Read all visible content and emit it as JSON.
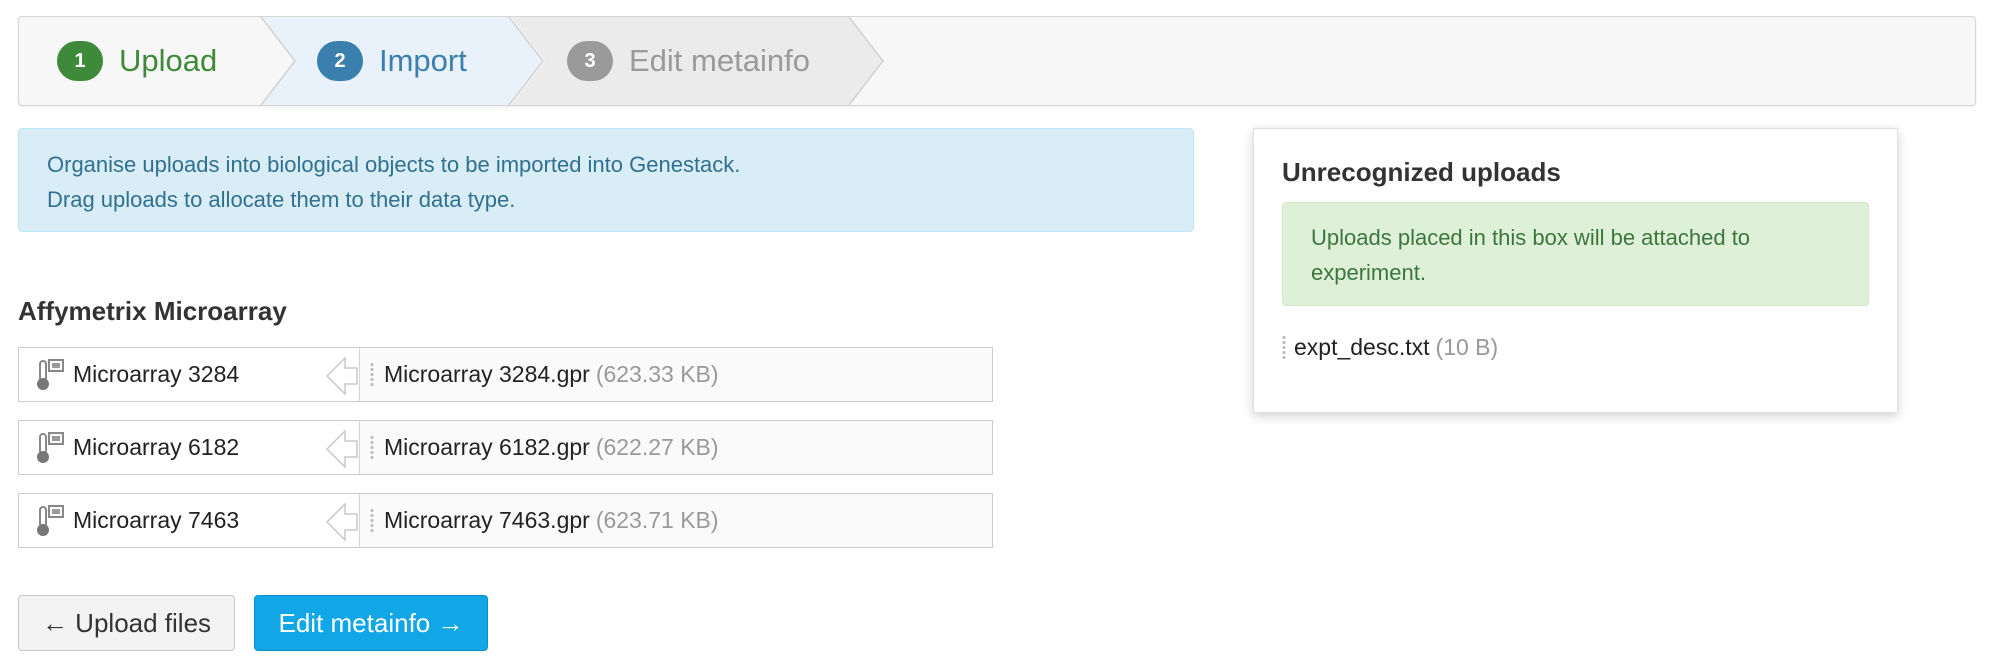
{
  "stepper": {
    "steps": [
      {
        "number": "1",
        "label": "Upload",
        "state": "completed",
        "color": "#3f8a3a"
      },
      {
        "number": "2",
        "label": "Import",
        "state": "active",
        "color": "#3b7fae"
      },
      {
        "number": "3",
        "label": "Edit metainfo",
        "state": "pending",
        "color": "#9a9a9a"
      }
    ]
  },
  "info_alert": {
    "line1": "Organise uploads into biological objects to be imported into Genestack.",
    "line2": "Drag uploads to allocate them to their data type."
  },
  "section": {
    "title": "Affymetrix Microarray",
    "rows": [
      {
        "object_icon": "microarray-icon",
        "object": "Microarray 3284",
        "file": "Microarray 3284.gpr",
        "size": "(623.33 KB)"
      },
      {
        "object_icon": "microarray-icon",
        "object": "Microarray 6182",
        "file": "Microarray 6182.gpr",
        "size": "(622.27 KB)"
      },
      {
        "object_icon": "microarray-icon",
        "object": "Microarray 7463",
        "file": "Microarray 7463.gpr",
        "size": "(623.71 KB)"
      }
    ]
  },
  "buttons": {
    "back_label": "← Upload files",
    "next_label": "Edit metainfo →",
    "next_color": "#11a6e6"
  },
  "unrecognized": {
    "title": "Unrecognized uploads",
    "alert_line1": "Uploads placed in this box will be attached to",
    "alert_line2": "experiment.",
    "file": "expt_desc.txt",
    "size": "(10 B)"
  }
}
